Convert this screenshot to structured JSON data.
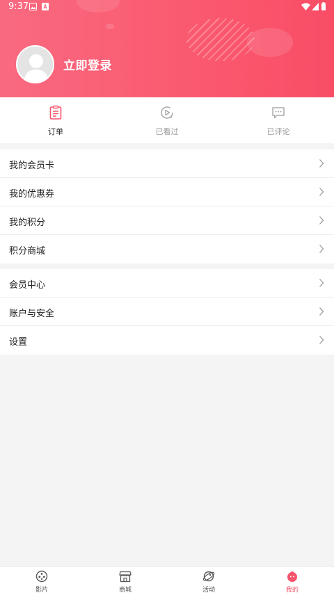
{
  "status_bar": {
    "time": "9:37"
  },
  "profile": {
    "login_text": "立即登录"
  },
  "tabs": [
    {
      "label": "订单",
      "icon": "order-icon",
      "active": true
    },
    {
      "label": "已看过",
      "icon": "play-history-icon",
      "active": false
    },
    {
      "label": "已评论",
      "icon": "comment-icon",
      "active": false
    }
  ],
  "menu_group_1": [
    {
      "label": "我的会员卡"
    },
    {
      "label": "我的优惠券"
    },
    {
      "label": "我的积分"
    },
    {
      "label": "积分商城"
    }
  ],
  "menu_group_2": [
    {
      "label": "会员中心"
    },
    {
      "label": "账户与安全"
    },
    {
      "label": "设置"
    }
  ],
  "bottom_nav": [
    {
      "label": "影片",
      "icon": "film-reel-icon",
      "active": false
    },
    {
      "label": "商城",
      "icon": "store-icon",
      "active": false
    },
    {
      "label": "活动",
      "icon": "planet-icon",
      "active": false
    },
    {
      "label": "我的",
      "icon": "mascot-icon",
      "active": true
    }
  ],
  "colors": {
    "accent": "#f5546c",
    "header_start": "#f96a80",
    "header_end": "#f94d66"
  }
}
